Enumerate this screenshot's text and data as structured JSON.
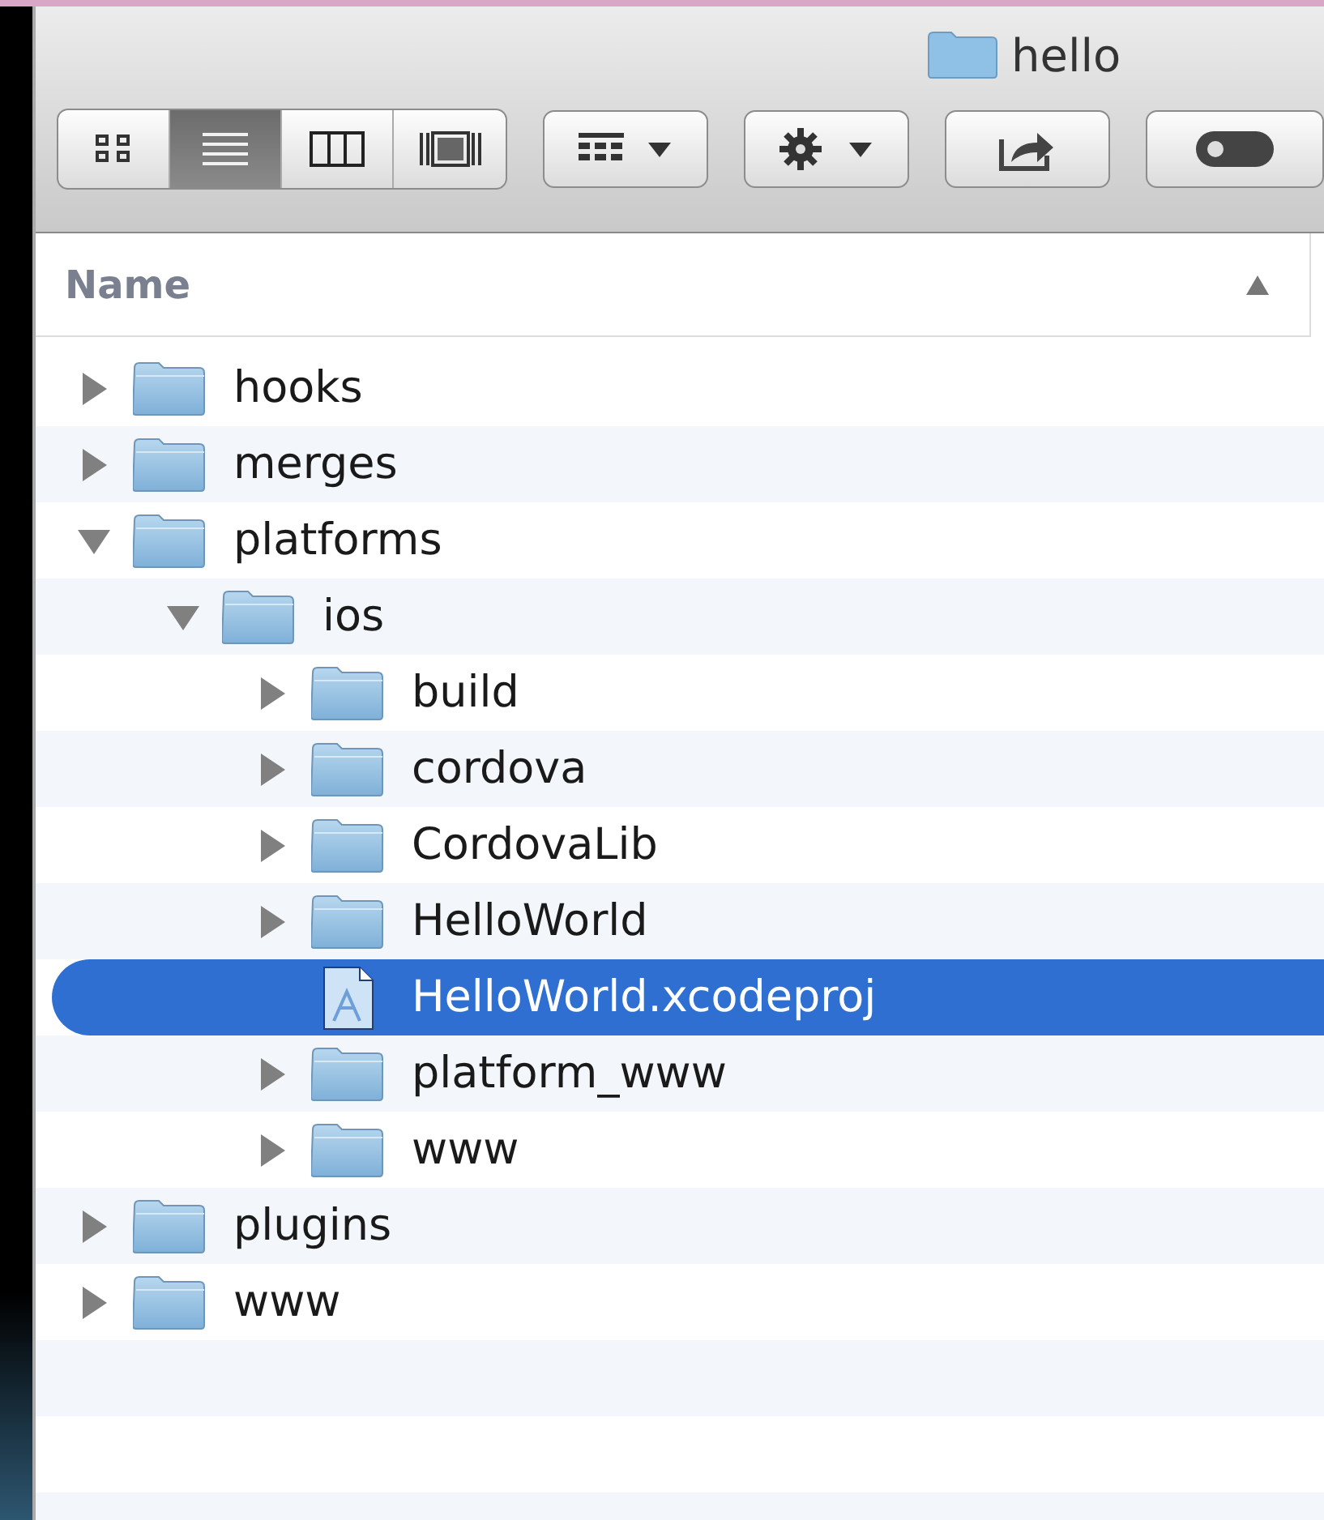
{
  "window": {
    "title": "hello"
  },
  "view_modes": [
    {
      "kind": "icons",
      "selected": false
    },
    {
      "kind": "list",
      "selected": true
    },
    {
      "kind": "columns",
      "selected": false
    },
    {
      "kind": "coverflow",
      "selected": false
    }
  ],
  "toolbar_buttons": [
    {
      "kind": "arrange"
    },
    {
      "kind": "action"
    },
    {
      "kind": "share"
    },
    {
      "kind": "tags"
    }
  ],
  "column_header": {
    "label": "Name",
    "ascending": true
  },
  "tree": [
    {
      "name": "hooks",
      "kind": "folder",
      "expanded": false,
      "selected": false
    },
    {
      "name": "merges",
      "kind": "folder",
      "expanded": false,
      "selected": false
    },
    {
      "name": "platforms",
      "kind": "folder",
      "expanded": true,
      "selected": false,
      "children": [
        {
          "name": "ios",
          "kind": "folder",
          "expanded": true,
          "selected": false,
          "children": [
            {
              "name": "build",
              "kind": "folder",
              "expanded": false,
              "selected": false
            },
            {
              "name": "cordova",
              "kind": "folder",
              "expanded": false,
              "selected": false
            },
            {
              "name": "CordovaLib",
              "kind": "folder",
              "expanded": false,
              "selected": false
            },
            {
              "name": "HelloWorld",
              "kind": "folder",
              "expanded": false,
              "selected": false
            },
            {
              "name": "HelloWorld.xcodeproj",
              "kind": "file",
              "selected": true
            },
            {
              "name": "platform_www",
              "kind": "folder",
              "expanded": false,
              "selected": false
            },
            {
              "name": "www",
              "kind": "folder",
              "expanded": false,
              "selected": false
            }
          ]
        }
      ]
    },
    {
      "name": "plugins",
      "kind": "folder",
      "expanded": false,
      "selected": false
    },
    {
      "name": "www",
      "kind": "folder",
      "expanded": false,
      "selected": false
    }
  ]
}
